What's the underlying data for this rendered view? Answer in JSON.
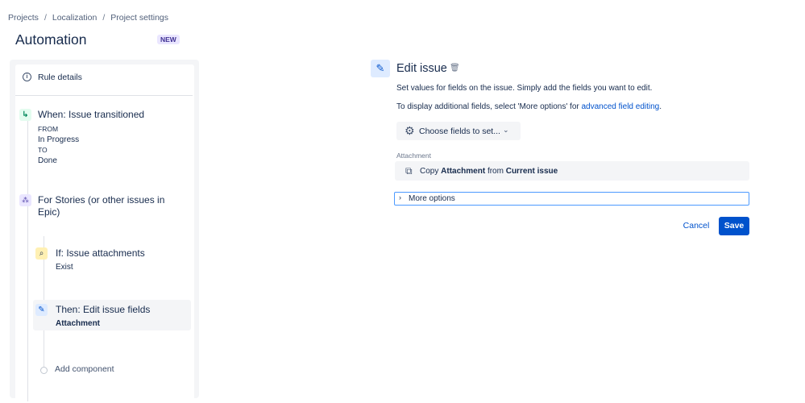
{
  "breadcrumb": {
    "items": [
      "Projects",
      "Localization",
      "Project settings"
    ],
    "separator": "/"
  },
  "page": {
    "title": "Automation",
    "badge": "NEW"
  },
  "rule_panel": {
    "details_label": "Rule details",
    "trigger": {
      "title": "When: Issue transitioned",
      "from_label": "FROM",
      "from_value": "In Progress",
      "to_label": "TO",
      "to_value": "Done"
    },
    "branch": {
      "title": "For Stories (or other issues in Epic)"
    },
    "condition": {
      "title": "If: Issue attachments",
      "detail": "Exist"
    },
    "action": {
      "title": "Then: Edit issue fields",
      "detail": "Attachment"
    },
    "add_component_label": "Add component"
  },
  "editor": {
    "title": "Edit issue",
    "description": "Set values for fields on the issue. Simply add the fields you want to edit.",
    "more_info_prefix": "To display additional fields, select 'More options' for ",
    "more_info_link": "advanced field editing",
    "more_info_suffix": ".",
    "choose_fields_label": "Choose fields to set...",
    "field_label": "Attachment",
    "field_copy_prefix": "Copy",
    "field_copy_field": "Attachment",
    "field_copy_middle": "from",
    "field_copy_source": "Current issue",
    "more_options_label": "More options",
    "cancel_label": "Cancel",
    "save_label": "Save"
  },
  "colors": {
    "primary": "#0052cc",
    "text": "#172b4d",
    "subtle": "#f4f5f7",
    "badge_bg": "#eae6ff",
    "badge_text": "#403294"
  },
  "icons": [
    "info-icon",
    "transition-icon",
    "branch-icon",
    "paperclip-icon",
    "pencil-icon",
    "trash-icon",
    "gear-icon",
    "chevron-down-icon",
    "copy-icon",
    "chevron-right-icon"
  ]
}
